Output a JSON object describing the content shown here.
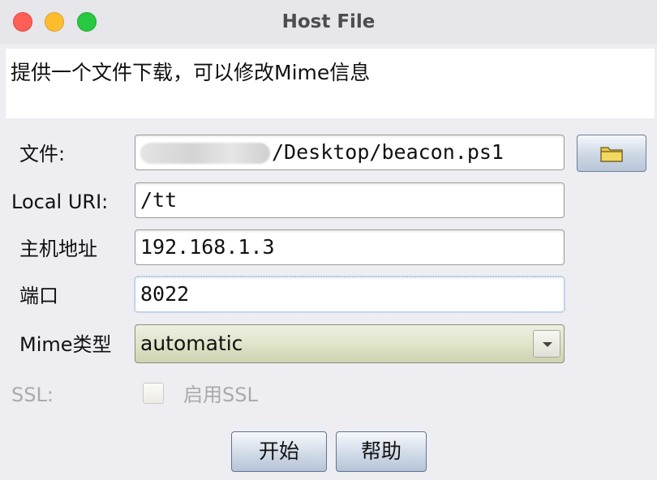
{
  "window": {
    "title": "Host File"
  },
  "description": "提供一个文件下载，可以修改Mime信息",
  "form": {
    "file_label": "文件:",
    "file_value": "/Desktop/beacon.ps1",
    "uri_label": "Local URI:",
    "uri_value": "/tt",
    "host_label": "主机地址",
    "host_value": "192.168.1.3",
    "port_label": "端口",
    "port_value": "8022",
    "mime_label": "Mime类型",
    "mime_value": "automatic",
    "ssl_label": "SSL:",
    "ssl_checkbox_label": "启用SSL",
    "ssl_checked": false
  },
  "buttons": {
    "start": "开始",
    "help": "帮助"
  },
  "icons": {
    "browse": "folder-icon",
    "dropdown": "chevron-down-icon"
  }
}
